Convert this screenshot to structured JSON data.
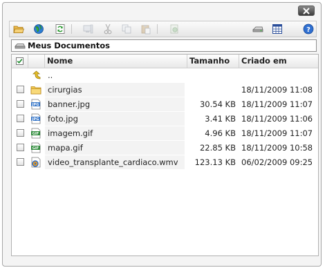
{
  "toolbar": {
    "buttons": [
      {
        "name": "open-folder-icon",
        "enabled": true
      },
      {
        "name": "globe-icon",
        "enabled": true
      },
      {
        "name": "refresh-icon",
        "enabled": true
      },
      {
        "name": "view-icon",
        "enabled": false
      },
      {
        "name": "cut-icon",
        "enabled": false
      },
      {
        "name": "copy-icon",
        "enabled": false
      },
      {
        "name": "paste-icon",
        "enabled": false
      },
      {
        "name": "delete-icon",
        "enabled": false
      },
      {
        "name": "drive-icon",
        "enabled": true
      },
      {
        "name": "grid-view-icon",
        "enabled": true
      },
      {
        "name": "help-icon",
        "enabled": true
      }
    ]
  },
  "path": {
    "label": "Meus Documentos"
  },
  "columns": {
    "name": "Nome",
    "size": "Tamanho",
    "created": "Criado em"
  },
  "rows": [
    {
      "type": "up",
      "name": "..",
      "size": "",
      "created": ""
    },
    {
      "type": "folder",
      "name": "cirurgias",
      "size": "",
      "created": "18/11/2009 11:08"
    },
    {
      "type": "jpg",
      "name": "banner.jpg",
      "size": "30.54 KB",
      "created": "18/11/2009 11:07"
    },
    {
      "type": "jpg",
      "name": "foto.jpg",
      "size": "3.41 KB",
      "created": "18/11/2009 11:06"
    },
    {
      "type": "gif",
      "name": "imagem.gif",
      "size": "4.96 KB",
      "created": "18/11/2009 11:07"
    },
    {
      "type": "gif",
      "name": "mapa.gif",
      "size": "22.85 KB",
      "created": "18/11/2009 10:58"
    },
    {
      "type": "wmv",
      "name": "video_transplante_cardiaco.wmv",
      "size": "123.13 KB",
      "created": "06/02/2009 09:25"
    }
  ],
  "colors": {
    "accent": "#1a8a2a",
    "header_bg": "#efefef",
    "close_bg": "#4a4a4a"
  }
}
